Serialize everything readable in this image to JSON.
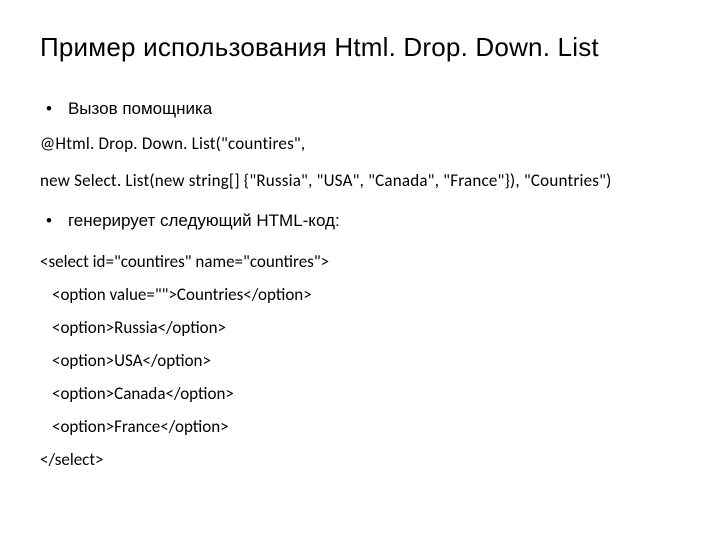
{
  "title": "Пример использования Html. Drop. Down. List",
  "bullet1": "Вызов помощника",
  "code_line1": "@Html. Drop. Down. List(\"countires\",",
  "code_line2": "new Select. List(new string[] {\"Russia\", \"USA\", \"Canada\", \"France\"}), \"Countries\")",
  "bullet2": "генерирует следующий HTML-код:",
  "html_lines": {
    "l1": "<select id=\"countires\" name=\"countires\">",
    "l2": "<option value=\"\">Countries</option>",
    "l3": "<option>Russia</option>",
    "l4": "<option>USA</option>",
    "l5": "<option>Canada</option>",
    "l6": "<option>France</option>",
    "l7": "</select>"
  }
}
